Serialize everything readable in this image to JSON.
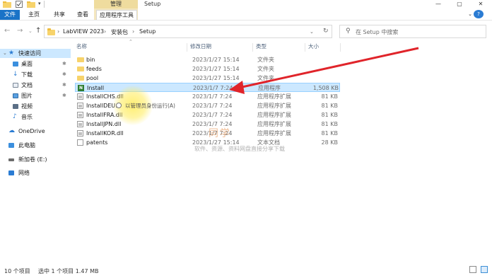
{
  "window": {
    "title": "Setup",
    "tabs": {
      "file": "文件",
      "home": "主页",
      "share": "共享",
      "view": "查看",
      "app_tools": "应用程序工具"
    },
    "context_group": "管理"
  },
  "address": {
    "breadcrumbs": [
      "LabVIEW 2023",
      "安装包",
      "Setup"
    ],
    "search_placeholder": "在 Setup 中搜索"
  },
  "nav": {
    "items": [
      {
        "label": "快速访问",
        "icon": "star-icon"
      },
      {
        "label": "桌面",
        "icon": "desktop-icon"
      },
      {
        "label": "下载",
        "icon": "download-icon"
      },
      {
        "label": "文档",
        "icon": "documents-icon"
      },
      {
        "label": "图片",
        "icon": "pictures-icon"
      },
      {
        "label": "视频",
        "icon": "videos-icon"
      },
      {
        "label": "音乐",
        "icon": "music-icon"
      },
      {
        "label": "OneDrive",
        "icon": "cloud-icon"
      },
      {
        "label": "此电脑",
        "icon": "computer-icon"
      },
      {
        "label": "新加卷 (E:)",
        "icon": "drive-icon"
      },
      {
        "label": "网络",
        "icon": "network-icon"
      }
    ]
  },
  "columns": {
    "name": "名称",
    "date": "修改日期",
    "type": "类型",
    "size": "大小"
  },
  "files": [
    {
      "name": "bin",
      "date": "2023/1/27 15:14",
      "type": "文件夹",
      "size": "",
      "kind": "folder"
    },
    {
      "name": "feeds",
      "date": "2023/1/27 15:14",
      "type": "文件夹",
      "size": "",
      "kind": "folder"
    },
    {
      "name": "pool",
      "date": "2023/1/27 15:14",
      "type": "文件夹",
      "size": "",
      "kind": "folder"
    },
    {
      "name": "Install",
      "date": "2023/1/7 7:24",
      "type": "应用程序",
      "size": "1,508 KB",
      "kind": "app"
    },
    {
      "name": "InstallCHS.dll",
      "date": "2023/1/7 7:24",
      "type": "应用程序扩展",
      "size": "81 KB",
      "kind": "dll"
    },
    {
      "name": "InstallDEU.",
      "date": "2023/1/7 7:24",
      "type": "应用程序扩展",
      "size": "81 KB",
      "kind": "dll"
    },
    {
      "name": "InstallFRA.dll",
      "date": "2023/1/7 7:24",
      "type": "应用程序扩展",
      "size": "81 KB",
      "kind": "dll"
    },
    {
      "name": "InstallJPN.dll",
      "date": "2023/1/7 7:24",
      "type": "应用程序扩展",
      "size": "81 KB",
      "kind": "dll"
    },
    {
      "name": "InstallKOR.dll",
      "date": "2023/1/7 7:24",
      "type": "应用程序扩展",
      "size": "81 KB",
      "kind": "dll"
    },
    {
      "name": "patents",
      "date": "2023/1/27 15:14",
      "type": "文本文档",
      "size": "28 KB",
      "kind": "txt"
    }
  ],
  "context_tooltip": "以管理员身份运行(A)",
  "watermark": {
    "brand": "同学",
    "tagline": "软件、资源、资料网盘直接分享下载"
  },
  "status": {
    "count": "10 个项目",
    "selection": "选中 1 个项目  1.47 MB"
  },
  "colors": {
    "accent": "#1a73c7",
    "selection": "#cce8ff",
    "arrow": "#e0242a"
  }
}
